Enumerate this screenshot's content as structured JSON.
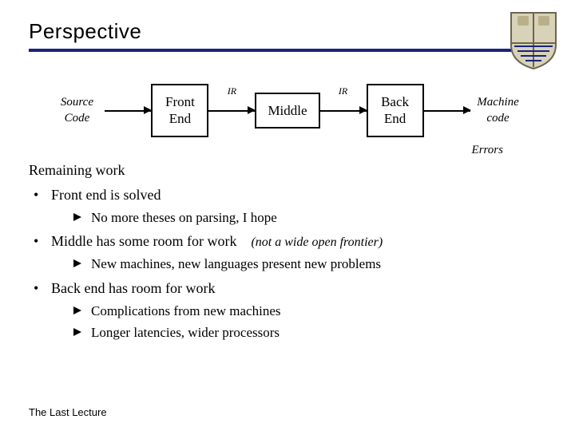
{
  "title": "Perspective",
  "pipeline": {
    "source": {
      "line1": "Source",
      "line2": "Code"
    },
    "front": {
      "line1": "Front",
      "line2": "End"
    },
    "ir1": "IR",
    "middle": "Middle",
    "ir2": "IR",
    "back": {
      "line1": "Back",
      "line2": "End"
    },
    "machine": {
      "line1": "Machine",
      "line2": "code"
    }
  },
  "errors_label": "Errors",
  "content": {
    "heading": "Remaining work",
    "items": [
      {
        "text": "Front end is solved",
        "sub": [
          "No more theses on parsing, I hope"
        ],
        "aside": ""
      },
      {
        "text": "Middle has some room for work",
        "sub": [
          "New machines, new languages present new problems"
        ],
        "aside": "(not a wide open frontier)"
      },
      {
        "text": "Back end has room for work",
        "sub": [
          "Complications from new machines",
          "Longer latencies, wider processors"
        ],
        "aside": ""
      }
    ]
  },
  "footer": "The Last Lecture"
}
